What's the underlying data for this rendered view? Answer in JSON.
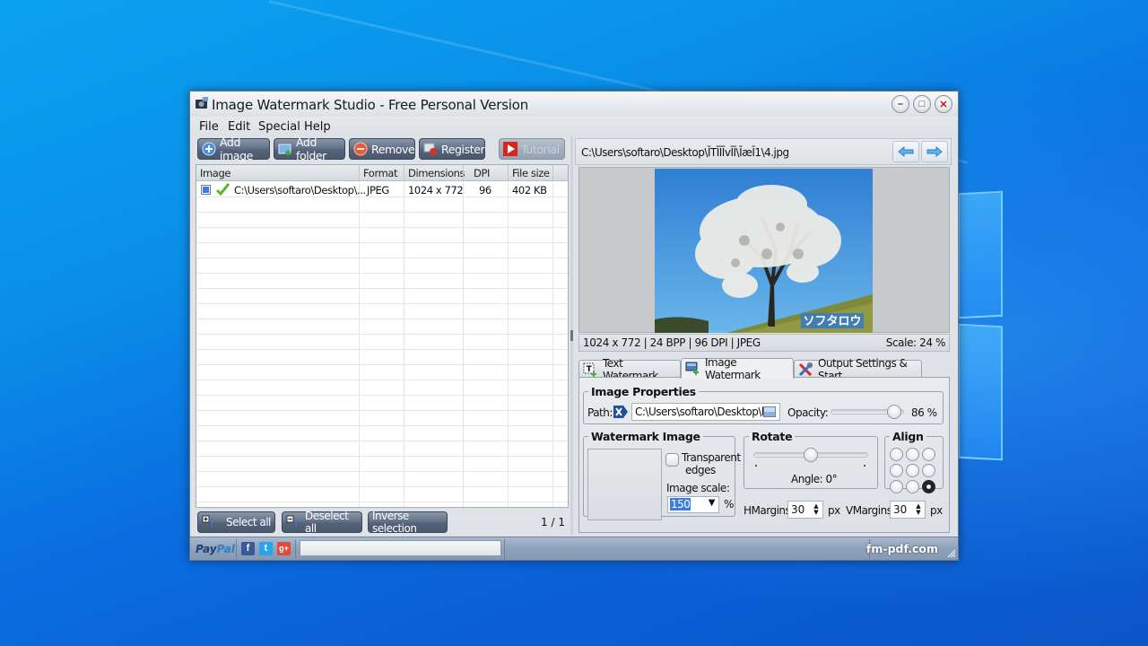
{
  "window": {
    "title": "Image Watermark Studio - Free Personal Version",
    "controls": {
      "minimize": "–",
      "maximize": "□",
      "close": "✕"
    }
  },
  "menu": [
    "File",
    "Edit",
    "Special",
    "Help"
  ],
  "toolbar": {
    "add_image": "Add image",
    "add_folder": "Add folder",
    "remove": "Remove",
    "register": "Register",
    "tutorial": "Tutorial"
  },
  "file_list": {
    "columns": [
      "Image",
      "Format",
      "Dimensions",
      "DPI",
      "File size"
    ],
    "rows": [
      {
        "checked": true,
        "status": "ok",
        "image": "C:\\Users\\softaro\\Desktop\\...",
        "format": "JPEG",
        "dimensions": "1024 x 772",
        "dpi": "96",
        "file_size": "402 KB"
      }
    ]
  },
  "list_actions": {
    "select_all": "Select all",
    "deselect_all": "Deselect all",
    "inverse_selection": "Inverse selection",
    "page_count": "1 / 1"
  },
  "preview": {
    "path": "C:\\Users\\softaro\\Desktop\\ĪTĪĪĪvĪĪ\\ĪæĪ1\\4.jpg",
    "watermark_text": "ソフタロウ",
    "info": "1024 x 772  |  24 BPP  |  96 DPI  |  JPEG",
    "scale": "Scale: 24 %"
  },
  "tabs": [
    {
      "label": "Text Watermark",
      "active": false
    },
    {
      "label": "Image Watermark",
      "active": true
    },
    {
      "label": "Output Settings & Start",
      "active": false
    }
  ],
  "image_properties": {
    "legend": "Image Properties",
    "path_label": "Path:",
    "path_value": "C:\\Users\\softaro\\Desktop\\he",
    "opacity_label": "Opacity:",
    "opacity_value": 86,
    "opacity_text": "86 %"
  },
  "watermark_image": {
    "legend": "Watermark Image",
    "transparent_edges_label_1": "Transparent",
    "transparent_edges_label_2": "edges",
    "transparent_edges_checked": false,
    "image_scale_label": "Image scale:",
    "image_scale_value": "150",
    "percent": "%"
  },
  "rotate": {
    "legend": "Rotate",
    "angle_text": "Angle: 0°",
    "angle_value": 0
  },
  "align": {
    "legend": "Align",
    "selected": "bottom-right"
  },
  "margins": {
    "hmargins_label": "HMargins:",
    "hmargins_value": "30",
    "vmargins_label": "VMargins:",
    "vmargins_value": "30",
    "unit": "px"
  },
  "statusbar": {
    "paypal_1": "Pay",
    "paypal_2": "Pal",
    "facebook": "f",
    "twitter": "t",
    "google": "g+",
    "site": "fm-pdf.com"
  },
  "colors": {
    "desktop": "#0a8fe8",
    "button": "#5a6980",
    "accent": "#3f7ae0"
  }
}
